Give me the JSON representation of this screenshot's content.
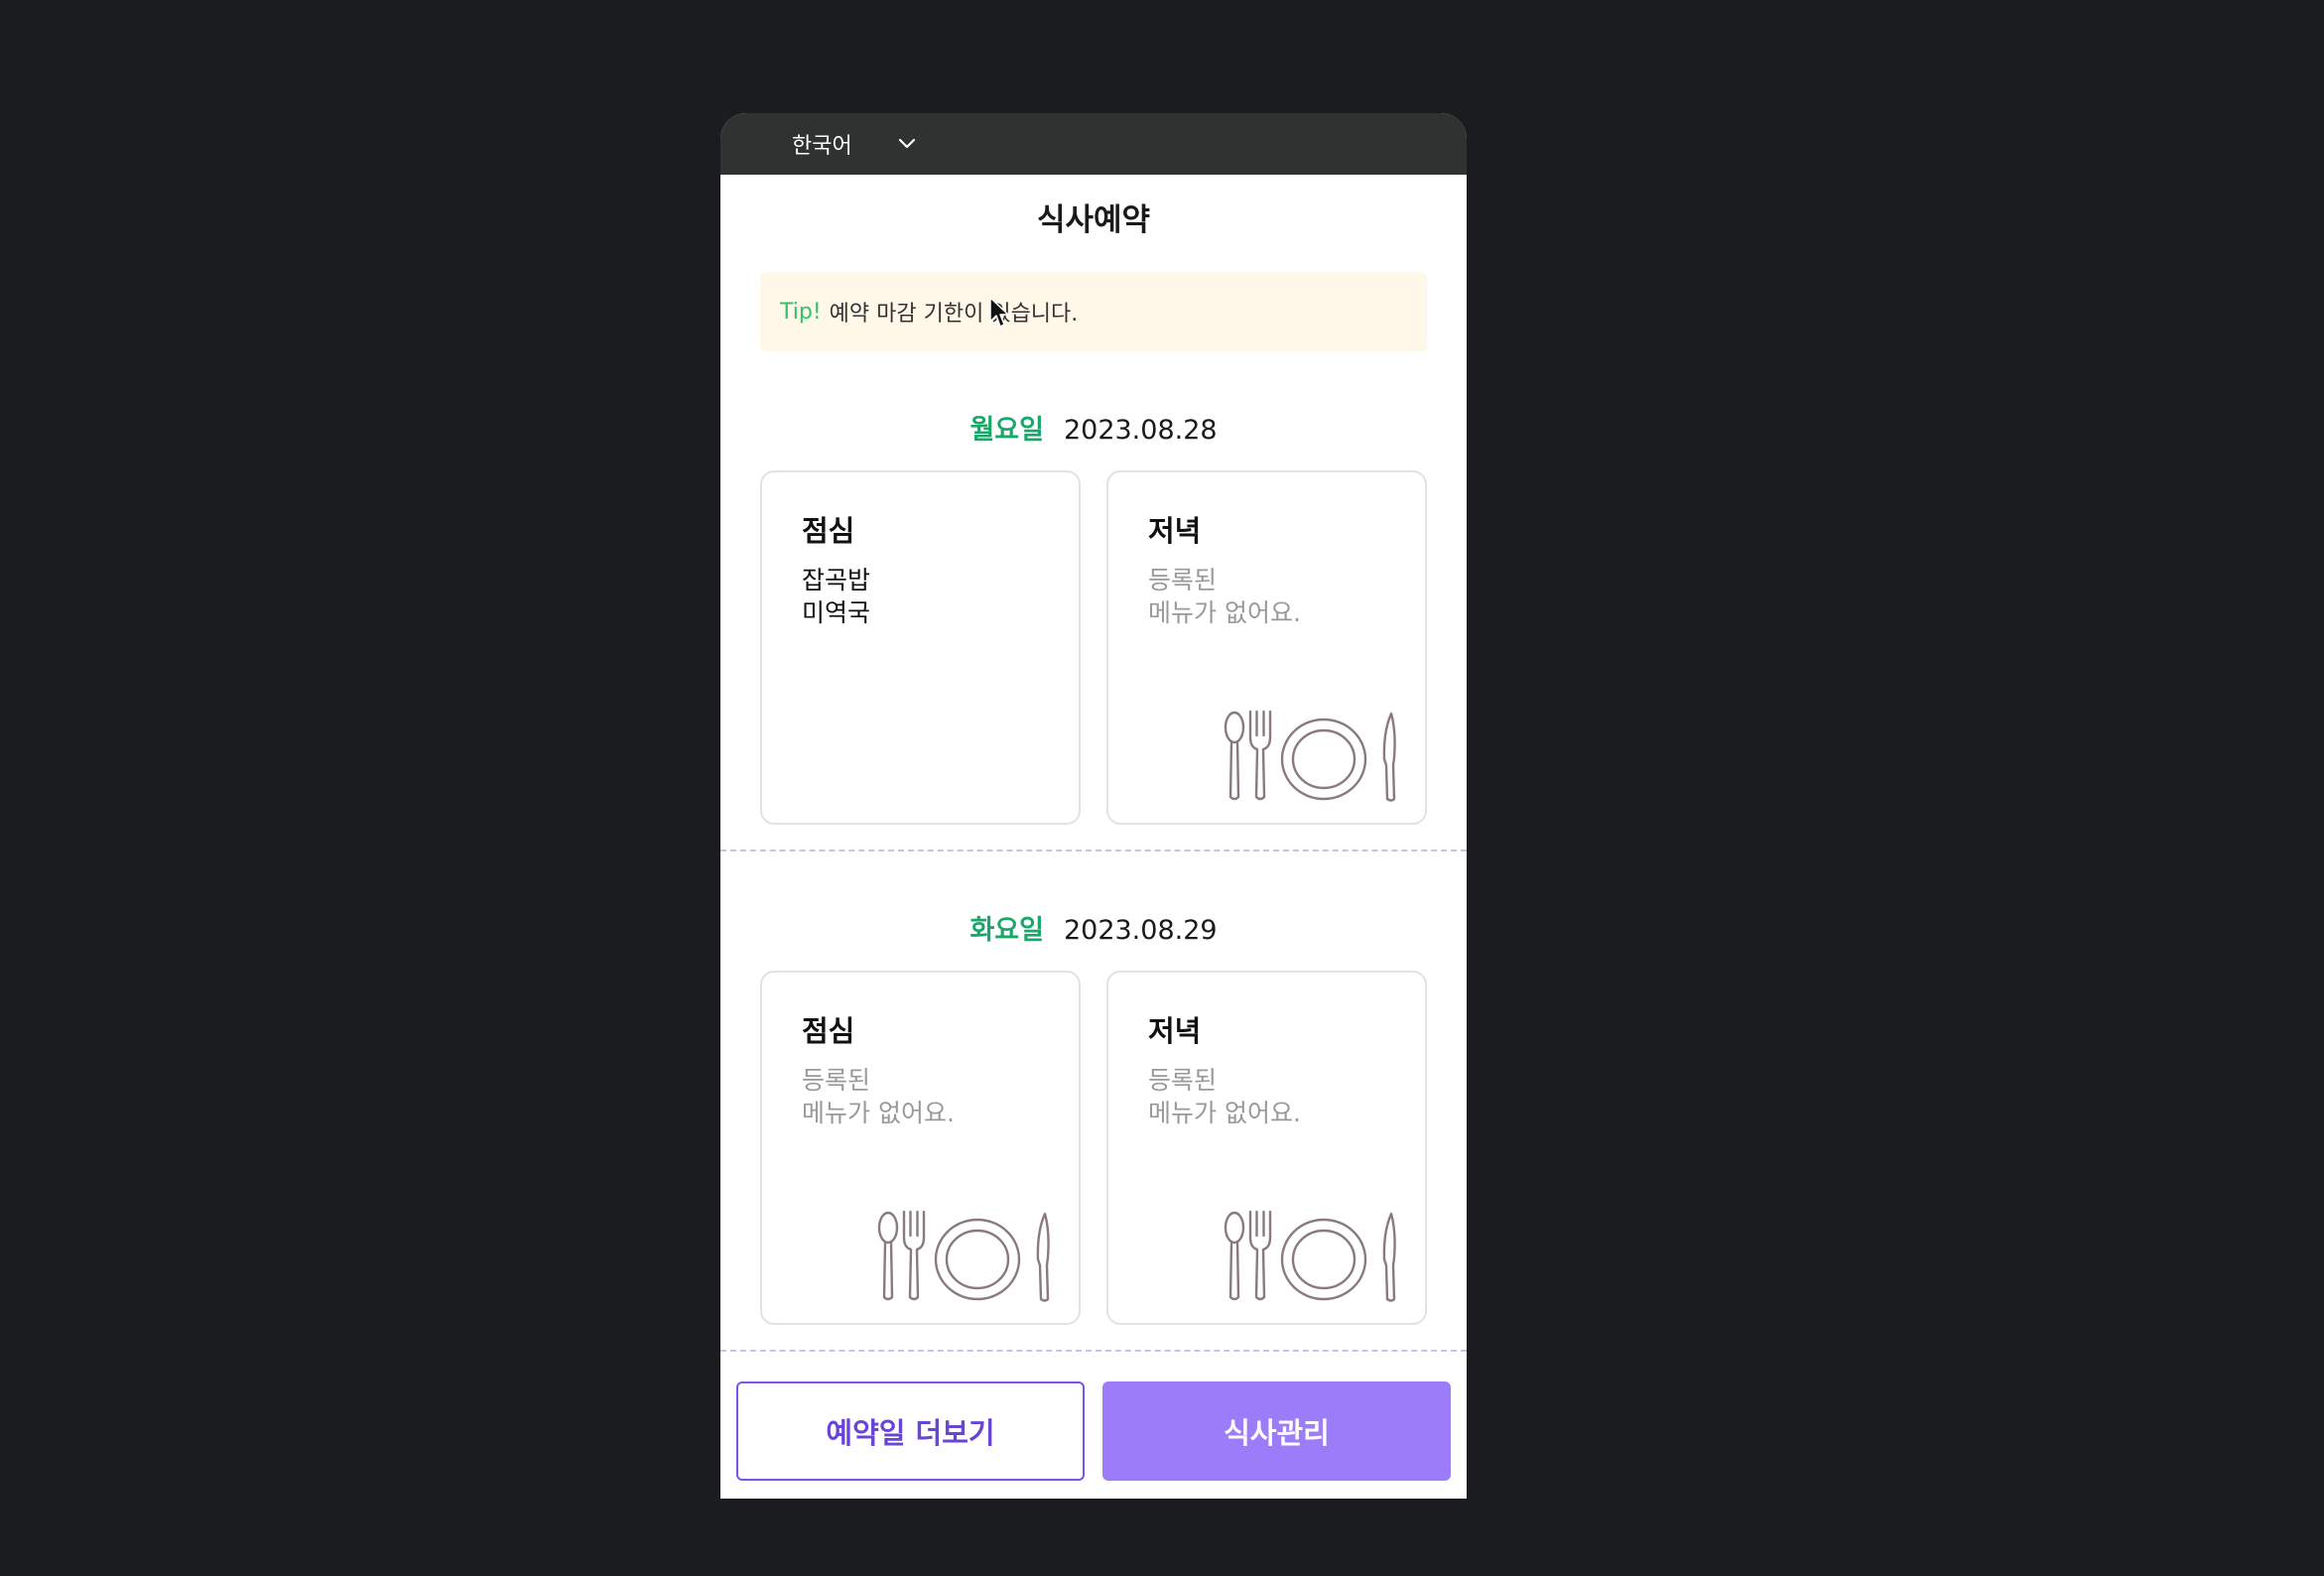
{
  "language_selector": {
    "value": "한국어",
    "icon": "chevron-down-icon"
  },
  "page": {
    "title": "식사예약"
  },
  "tip": {
    "label": "Tip!",
    "text": "예약 마감 기한이 있습니다."
  },
  "days": [
    {
      "weekday": "월요일",
      "date": "2023.08.28",
      "meals": [
        {
          "name": "점심",
          "menu": [
            "잡곡밥",
            "미역국"
          ],
          "empty": false
        },
        {
          "name": "저녁",
          "empty_text": [
            "등록된",
            "메뉴가 없어요."
          ],
          "empty": true
        }
      ]
    },
    {
      "weekday": "화요일",
      "date": "2023.08.29",
      "meals": [
        {
          "name": "점심",
          "empty_text": [
            "등록된",
            "메뉴가 없어요."
          ],
          "empty": true
        },
        {
          "name": "저녁",
          "empty_text": [
            "등록된",
            "메뉴가 없어요."
          ],
          "empty": true
        }
      ]
    }
  ],
  "buttons": {
    "more_dates": "예약일 더보기",
    "meal_manage": "식사관리"
  },
  "colors": {
    "accent_green": "#1aa86a",
    "accent_purple": "#9d7cfa",
    "tip_background": "#fff7e8",
    "topbar": "#2e3331"
  }
}
